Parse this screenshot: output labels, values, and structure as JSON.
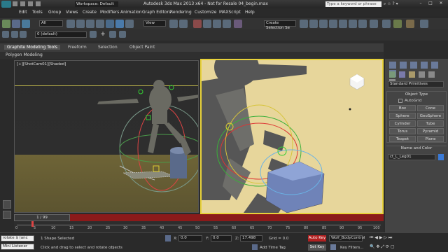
{
  "title": {
    "workspace": "Workspace: Default",
    "app_title": "Autodesk 3ds Max  2013 x64  -  Not for Resale    04_begin.max",
    "search_placeholder": "Type a keyword or phrase"
  },
  "menu": [
    "Edit",
    "Tools",
    "Group",
    "Views",
    "Create",
    "Modifiers",
    "Animation",
    "Graph Editors",
    "Rendering",
    "Customize",
    "MAXScript",
    "Help"
  ],
  "toolbar": {
    "filter": "All",
    "view": "View",
    "selection_set": "Create Selection Se",
    "layer": "0 (default)"
  },
  "ribbon": {
    "tabs": [
      "Graphite Modeling Tools",
      "Freeform",
      "Selection",
      "Object Paint"
    ],
    "sub": "Polygon Modeling"
  },
  "viewport": {
    "label": "[+][ShotCam01][Shaded]"
  },
  "panel": {
    "dropdown": "Standard Primitives",
    "object_type": "Object Type",
    "autogrid": "AutoGrid",
    "buttons": [
      "Box",
      "Cone",
      "Sphere",
      "GeoSphere",
      "Cylinder",
      "Tube",
      "Torus",
      "Pyramid",
      "Teapot",
      "Plane"
    ],
    "name_and_color": "Name and Color",
    "name_value": "ct_L_Leg01"
  },
  "timeline": {
    "frame": "1 / 99",
    "ticks": [
      "0",
      "5",
      "10",
      "15",
      "20",
      "25",
      "30",
      "35",
      "40",
      "45",
      "50",
      "55",
      "60",
      "65",
      "70",
      "75",
      "80",
      "85",
      "90",
      "95",
      "100"
    ]
  },
  "status": {
    "maxscript": "rotate $ (anc",
    "listener": "Mini Listener",
    "selected": "1 Shape Selected",
    "prompt": "Click and drag to select and rotate objects",
    "x_label": "X:",
    "x_value": "0.0",
    "y_label": "Y:",
    "y_value": "0.0",
    "z_label": "Z:",
    "z_value": "17.498",
    "grid": "Grid = 0.0",
    "add_time_tag": "Add Time Tag",
    "auto_key": "Auto Key",
    "set_key": "Set Key",
    "selected_obj": "Wolf_BodyControl",
    "key_filters": "Key Filters..."
  },
  "colors": {
    "timeline_red": "#8b1a1a",
    "viewport_active": "#e8d23a",
    "sky": "#e7d69b"
  }
}
